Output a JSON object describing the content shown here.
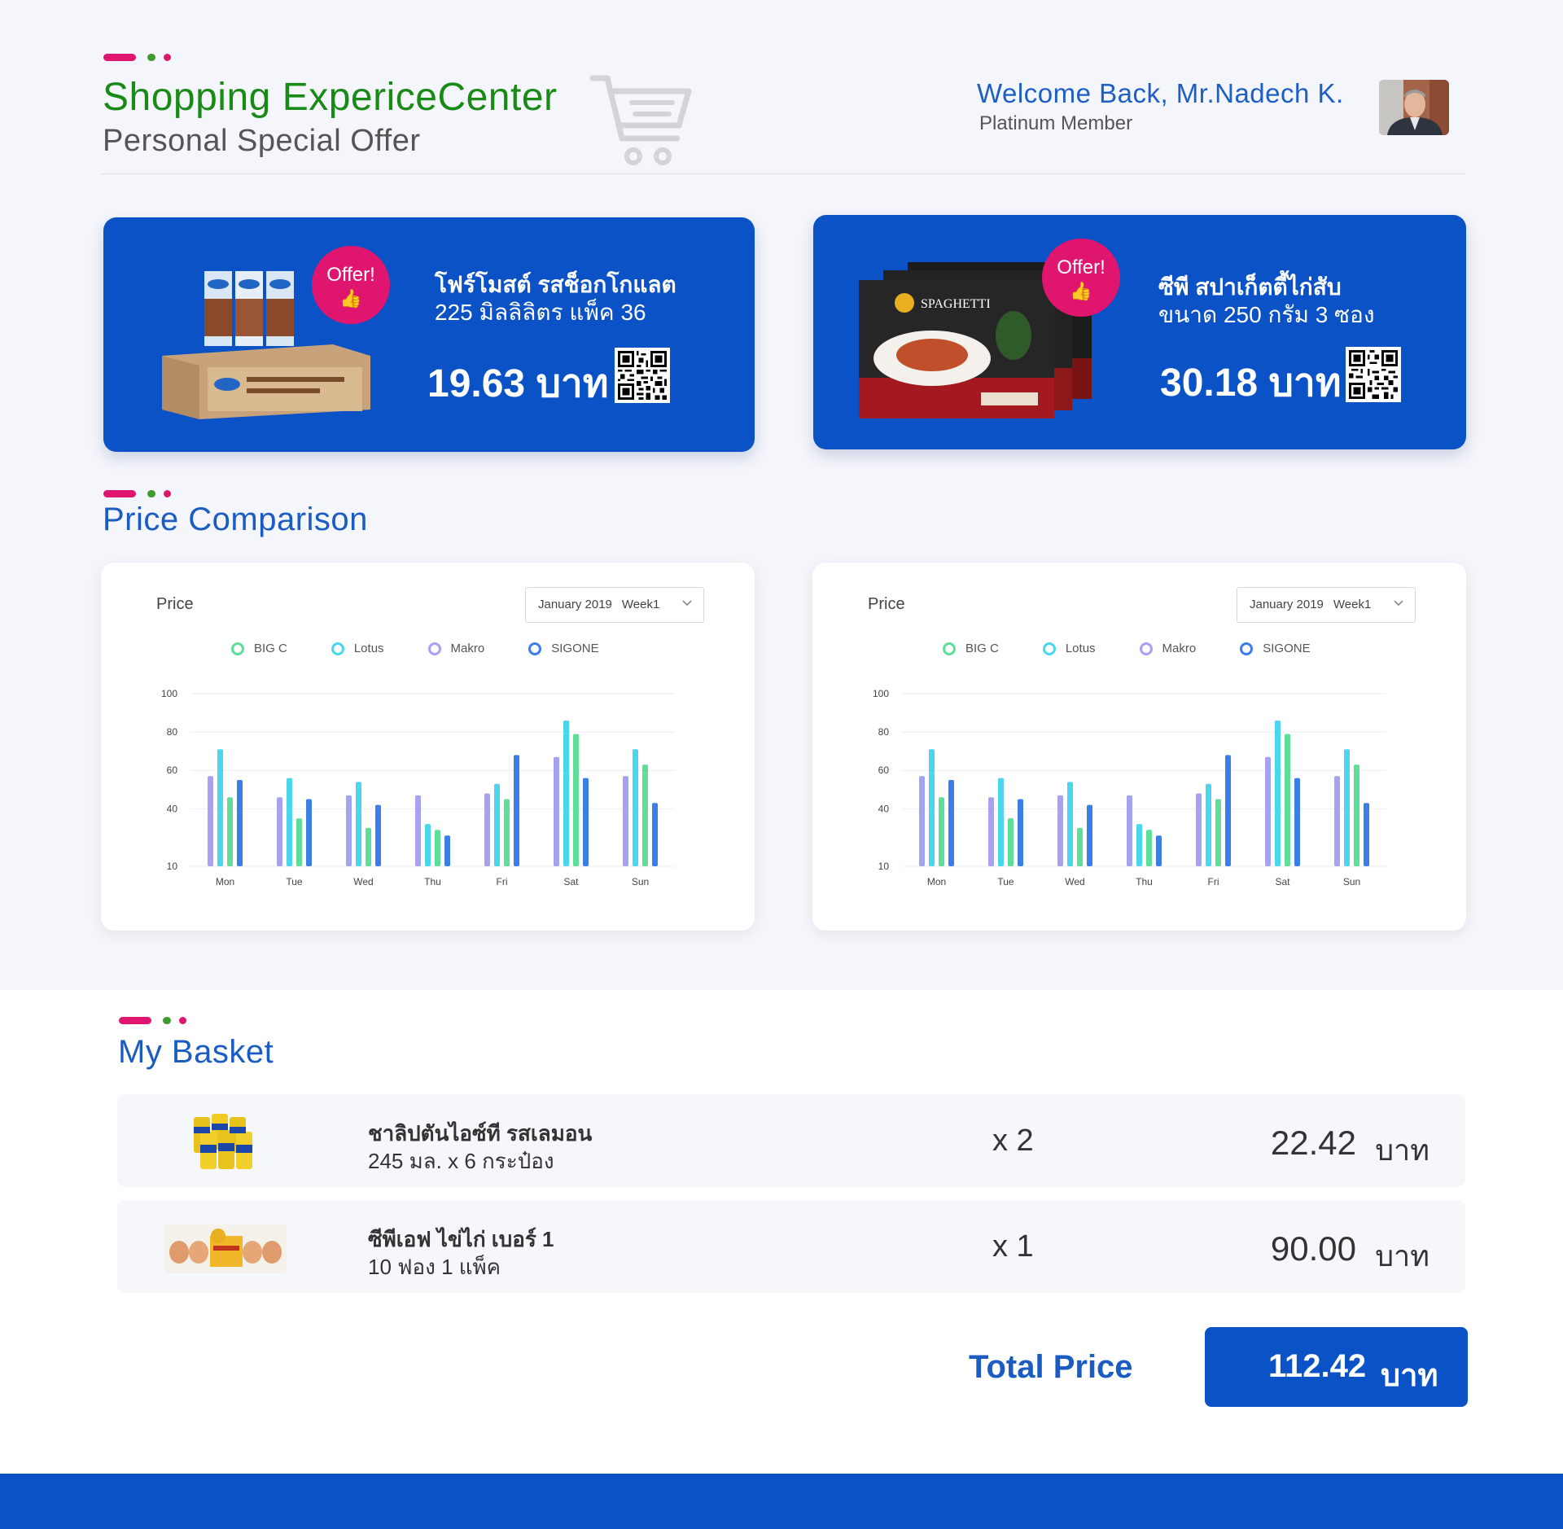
{
  "header": {
    "title": "Shopping ExpericeCenter",
    "subtitle": "Personal Special Offer",
    "welcome": "Welcome Back, Mr.Nadech K.",
    "member": "Platinum Member",
    "cart_icon": "shopping-cart-icon",
    "avatar_icon": "user-avatar"
  },
  "offers": [
    {
      "badge": "Offer!",
      "name_line1": "โฟร์โมสต์ รสช็อกโกแลต",
      "name_line2": "225 มิลลิลิตร แพ็ค 36",
      "price": "19.63 บาท",
      "icon": "thumbs-up-icon"
    },
    {
      "badge": "Offer!",
      "name_line1": "ซีพี สปาเก็ตตี้ไก่สับ",
      "name_line2": "ขนาด 250 กรัม 3 ซอง",
      "price": "30.18 บาท",
      "icon": "thumbs-up-icon"
    }
  ],
  "price_comparison": {
    "title": "Price Comparison",
    "charts": [
      {
        "label": "Price",
        "month": "January 2019",
        "week": "Week1"
      },
      {
        "label": "Price",
        "month": "January 2019",
        "week": "Week1"
      }
    ]
  },
  "chart_data": [
    {
      "type": "bar",
      "ylabel": "Price",
      "ylim": [
        10,
        100
      ],
      "yticks": [
        10,
        40,
        60,
        80,
        100
      ],
      "categories": [
        "Mon",
        "Tue",
        "Wed",
        "Thu",
        "Fri",
        "Sat",
        "Sun"
      ],
      "legend_position": "top",
      "series": [
        {
          "name": "Makro",
          "color": "#a6a1f0",
          "values": [
            57,
            46,
            47,
            47,
            48,
            67,
            57
          ]
        },
        {
          "name": "Lotus",
          "color": "#4ad7ee",
          "values": [
            71,
            56,
            54,
            32,
            53,
            86,
            71
          ]
        },
        {
          "name": "BIG C",
          "color": "#5fde9a",
          "values": [
            46,
            35,
            30,
            29,
            45,
            79,
            63
          ]
        },
        {
          "name": "SIGONE",
          "color": "#3b7ee8",
          "values": [
            55,
            45,
            42,
            26,
            68,
            56,
            43
          ]
        }
      ],
      "legend": [
        {
          "name": "BIG C",
          "color": "#5fde9a"
        },
        {
          "name": "Lotus",
          "color": "#4ad7ee"
        },
        {
          "name": "Makro",
          "color": "#a6a1f0"
        },
        {
          "name": "SIGONE",
          "color": "#3b7ee8"
        }
      ]
    },
    {
      "type": "bar",
      "ylabel": "Price",
      "ylim": [
        10,
        100
      ],
      "yticks": [
        10,
        40,
        60,
        80,
        100
      ],
      "categories": [
        "Mon",
        "Tue",
        "Wed",
        "Thu",
        "Fri",
        "Sat",
        "Sun"
      ],
      "legend_position": "top",
      "series": [
        {
          "name": "Makro",
          "color": "#a6a1f0",
          "values": [
            57,
            46,
            47,
            47,
            48,
            67,
            57
          ]
        },
        {
          "name": "Lotus",
          "color": "#4ad7ee",
          "values": [
            71,
            56,
            54,
            32,
            53,
            86,
            71
          ]
        },
        {
          "name": "BIG C",
          "color": "#5fde9a",
          "values": [
            46,
            35,
            30,
            29,
            45,
            79,
            63
          ]
        },
        {
          "name": "SIGONE",
          "color": "#3b7ee8",
          "values": [
            55,
            45,
            42,
            26,
            68,
            56,
            43
          ]
        }
      ],
      "legend": [
        {
          "name": "BIG C",
          "color": "#5fde9a"
        },
        {
          "name": "Lotus",
          "color": "#4ad7ee"
        },
        {
          "name": "Makro",
          "color": "#a6a1f0"
        },
        {
          "name": "SIGONE",
          "color": "#3b7ee8"
        }
      ]
    }
  ],
  "basket": {
    "title": "My Basket",
    "items": [
      {
        "name_line1": "ชาลิปตันไอซ์ที รสเลมอน",
        "name_line2": "245 มล. x 6 กระป๋อง",
        "qty": "x 2",
        "price": "22.42",
        "currency": "บาท",
        "image": "lemon-tea-cans-image"
      },
      {
        "name_line1": "ซีพีเอฟ ไข่ไก่ เบอร์ 1",
        "name_line2": "10 ฟอง 1 แพ็ค",
        "qty": "x 1",
        "price": "90.00",
        "currency": "บาท",
        "image": "egg-pack-image"
      }
    ],
    "total_label": "Total Price",
    "total_value": "112.42",
    "total_currency": "บาท"
  },
  "colors": {
    "brand_blue": "#0a52c5",
    "accent_pink": "#e0156f",
    "accent_green": "#1a8a17"
  }
}
